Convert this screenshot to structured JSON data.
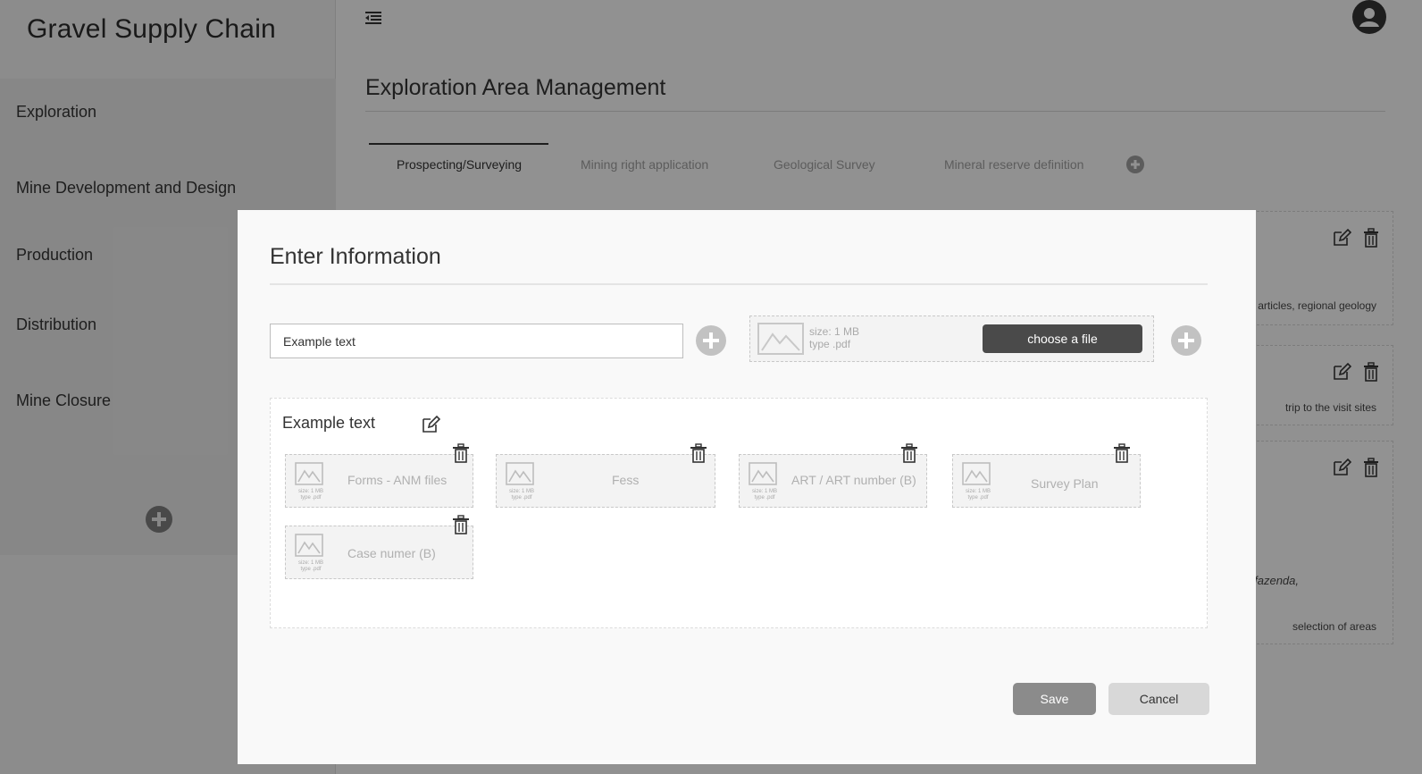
{
  "app": {
    "title": "Gravel Supply Chain"
  },
  "sidebar": {
    "items": [
      {
        "label": "Exploration"
      },
      {
        "label": "Mine Development and Design"
      },
      {
        "label": "Production"
      },
      {
        "label": "Distribution"
      },
      {
        "label": "Mine Closure"
      }
    ]
  },
  "header": {
    "menu_icon": "menu-collapse-icon",
    "avatar_icon": "user-avatar-icon"
  },
  "page": {
    "title": "Exploration Area Management",
    "tabs": [
      {
        "label": "Prospecting/Surveying",
        "active": true
      },
      {
        "label": "Mining right application",
        "active": false
      },
      {
        "label": "Geological Survey",
        "active": false
      },
      {
        "label": "Mineral reserve definition",
        "active": false
      }
    ],
    "background_cards": [
      {
        "text": "articles, regional geology"
      },
      {
        "text": "trip to the visit sites"
      },
      {
        "text": "fazenda,"
      },
      {
        "text": "selection of areas"
      }
    ]
  },
  "modal": {
    "title": "Enter Information",
    "text_input_value": "Example text",
    "upload": {
      "size": "size: 1 MB",
      "type": "type .pdf",
      "button_label": "choose a file"
    },
    "panel": {
      "title": "Example text",
      "files": [
        {
          "label": "Forms - ANM files",
          "size": "size: 1 MB",
          "type": "type .pdf"
        },
        {
          "label": "Fess",
          "size": "size: 1 MB",
          "type": "type .pdf"
        },
        {
          "label": "ART / ART number (B)",
          "size": "size: 1 MB",
          "type": "type .pdf"
        },
        {
          "label": "Survey Plan",
          "size": "size: 1 MB",
          "type": "type .pdf"
        },
        {
          "label": "Case numer (B)",
          "size": "size: 1 MB",
          "type": "type .pdf"
        }
      ]
    },
    "save_label": "Save",
    "cancel_label": "Cancel"
  },
  "colors": {
    "overlay": "#000000",
    "primary_button": "#4a4a4a",
    "save_button": "#8b8b8b",
    "cancel_button": "#d8d8d8"
  }
}
